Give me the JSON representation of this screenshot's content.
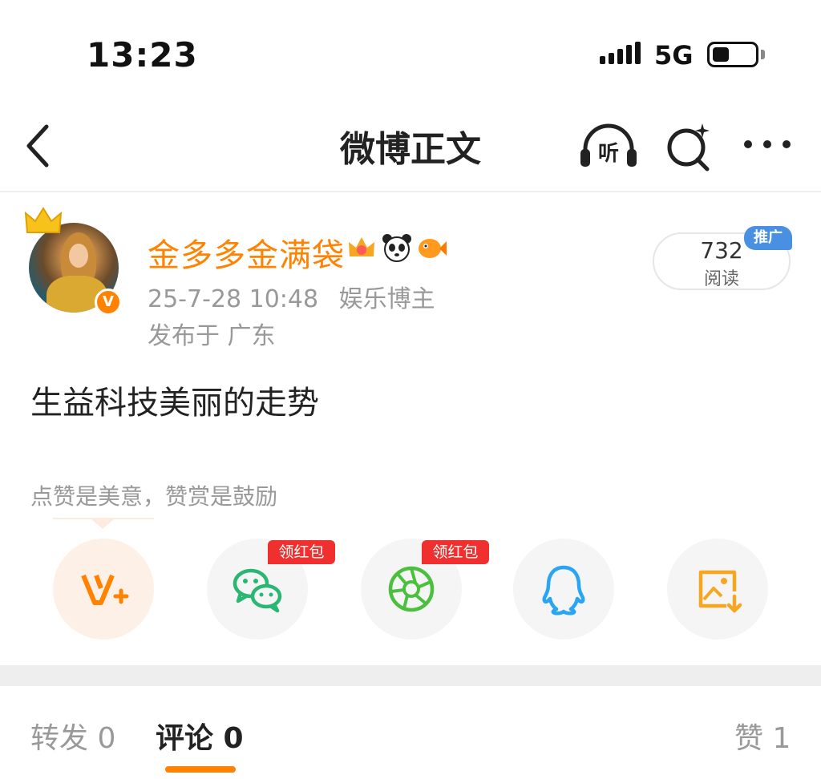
{
  "status_bar": {
    "time": "13:23",
    "network": "5G"
  },
  "nav": {
    "title": "微博正文",
    "listen_glyph": "听"
  },
  "author": {
    "name": "金多多金满袋",
    "verified_glyph": "V",
    "badges": [
      "crown-badge-icon",
      "panda-badge-icon",
      "fish-badge-icon"
    ]
  },
  "post": {
    "date": "25-7-28 10:48",
    "category": "娱乐博主",
    "location": "发布于 广东",
    "text": "生益科技美丽的走势",
    "reads": "732",
    "reads_label": "阅读",
    "promo": "推广"
  },
  "reward": {
    "hint": "点赞是美意，赞赏是鼓励"
  },
  "share": {
    "red_packet_label": "领红包",
    "items": [
      "reward-icon",
      "wechat-icon",
      "moments-icon",
      "qq-icon",
      "save-image-icon"
    ]
  },
  "tabs": {
    "repost": "转发 0",
    "comment": "评论 0",
    "like": "赞 1"
  },
  "colors": {
    "accent": "#ff8200",
    "meta": "#999999",
    "red_tag": "#f0302f",
    "wechat": "#2bb673",
    "qq": "#2aa4f4",
    "promo": "#4a90e2"
  }
}
